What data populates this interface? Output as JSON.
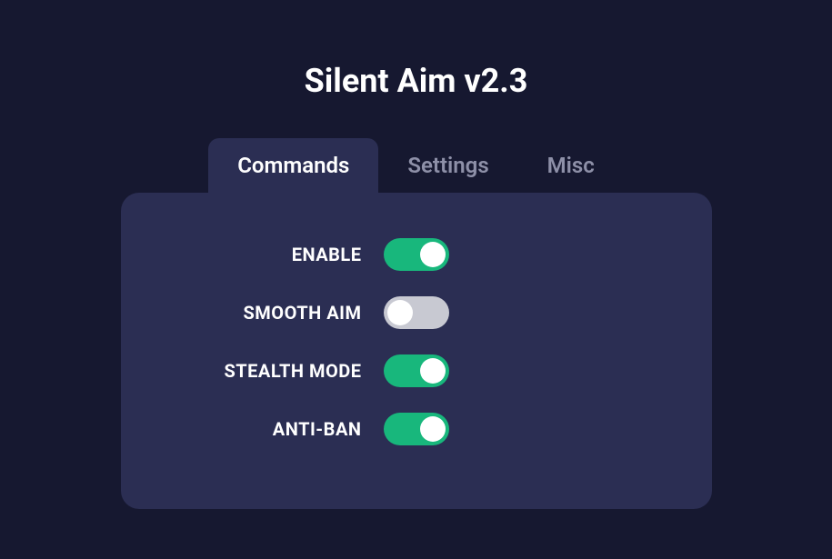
{
  "title": "Silent Aim v2.3",
  "tabs": [
    {
      "label": "Commands",
      "active": true
    },
    {
      "label": "Settings",
      "active": false
    },
    {
      "label": "Misc",
      "active": false
    }
  ],
  "options": [
    {
      "label": "ENABLE",
      "enabled": true
    },
    {
      "label": "SMOOTH AIM",
      "enabled": false
    },
    {
      "label": "STEALTH MODE",
      "enabled": true
    },
    {
      "label": "ANTI-BAN",
      "enabled": true
    }
  ]
}
